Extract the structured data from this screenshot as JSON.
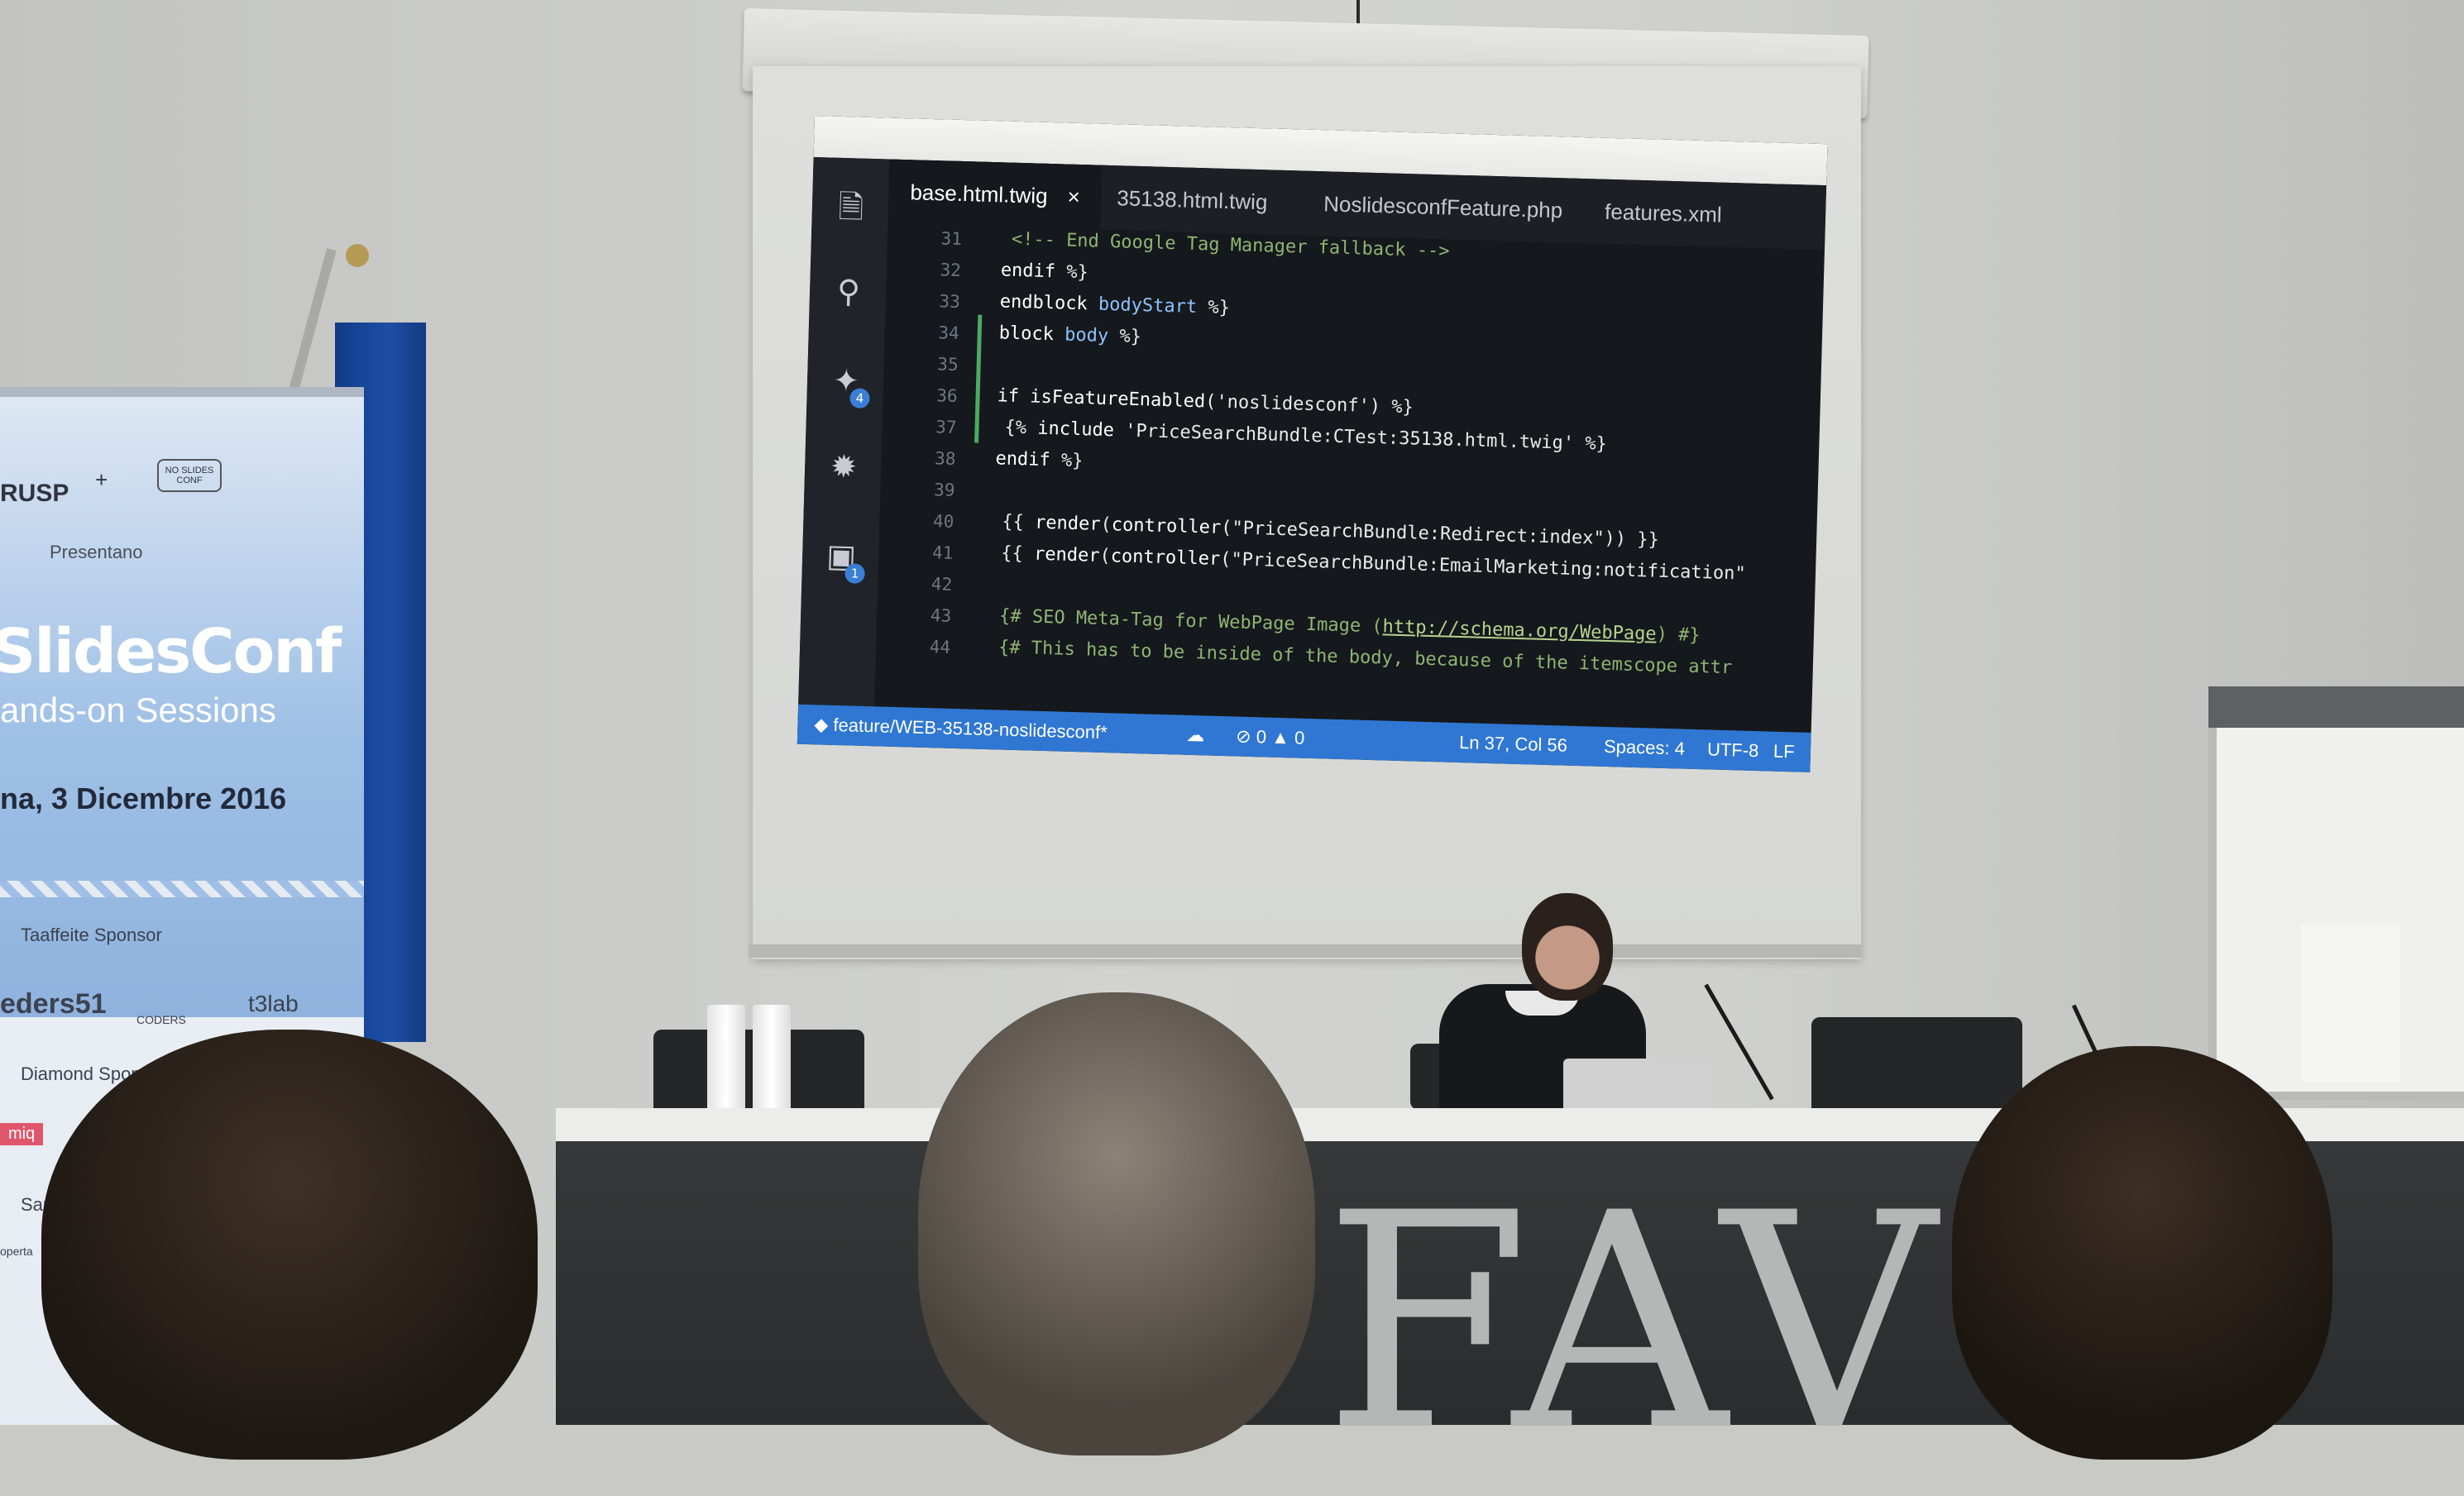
{
  "banner": {
    "logo_left": "RUSP",
    "plus": "+",
    "logo_right": "NO SLIDES CONF",
    "presentano": "Presentano",
    "title": "SlidesConf",
    "subtitle": "ands-on Sessions",
    "date": "na, 3 Dicembre 2016",
    "sponsor_heading_1": "Taaffeite Sponsor",
    "sponsor_1a": "eders51",
    "sponsor_1b": "CODERS",
    "sponsor_1c": "t3lab",
    "sponsor_heading_2": "Diamond Sponsor",
    "sponsor_2a": "miq",
    "sponsor_heading_3": "Sapphi",
    "sponsor_3a": "operta"
  },
  "editor": {
    "tabs": [
      {
        "label": "base.html.twig",
        "active": true
      },
      {
        "label": "35138.html.twig",
        "active": false
      },
      {
        "label": "NoslidesconfFeature.php",
        "active": false
      },
      {
        "label": "features.xml",
        "active": false
      }
    ],
    "close_glyph": "×",
    "activity_badges": [
      "4",
      "1"
    ],
    "line_numbers": [
      "31",
      "32",
      "33",
      "34",
      "35",
      "36",
      "37",
      "38",
      "39",
      "40",
      "41",
      "42",
      "43",
      "44"
    ],
    "code": {
      "l31": "<!-- End Google Tag Manager fallback -->",
      "l32_kw": "endif",
      "l32_end": "%}",
      "l33_kw": "endblock",
      "l33_id": "bodyStart",
      "l33_end": "%}",
      "l34_kw": "block",
      "l34_id": "body",
      "l34_end": "%}",
      "l36_kw": "if",
      "l36_fn": "isFeatureEnabled",
      "l36_arg": "('noslidesconf')",
      "l36_end": "%}",
      "l37_open": "{%",
      "l37_kw": "include",
      "l37_str": "'PriceSearchBundle:CTest:35138.html.twig'",
      "l37_end": "%}",
      "l38_kw": "endif",
      "l38_end": "%}",
      "l40_open": "{{",
      "l40_fn": "render",
      "l40_fn2": "controller",
      "l40_str": "(\"PriceSearchBundle:Redirect:index\"))",
      "l40_end": "}}",
      "l41_open": "{{",
      "l41_fn": "render",
      "l41_fn2": "controller",
      "l41_str": "(\"PriceSearchBundle:EmailMarketing:notification\"",
      "l43_open": "{# SEO Meta-Tag for WebPage Image (",
      "l43_link": "http://schema.org/WebPage",
      "l43_close": ") #}",
      "l44": "{# This has to be inside of the body, because of the itemscope attr"
    },
    "status": {
      "branch": "feature/WEB-35138-noslidesconf*",
      "errors": "0",
      "warnings": "0",
      "position": "Ln 37, Col 56",
      "spaces": "Spaces: 4",
      "encoding": "UTF-8",
      "eol": "LF"
    }
  },
  "desk": {
    "sign": "FAV"
  },
  "colors": {
    "status_bar": "#2f77d2",
    "editor_bg": "#15181c",
    "banner_blue": "#9fc0e6",
    "flag_blue": "#1d4ea6"
  }
}
